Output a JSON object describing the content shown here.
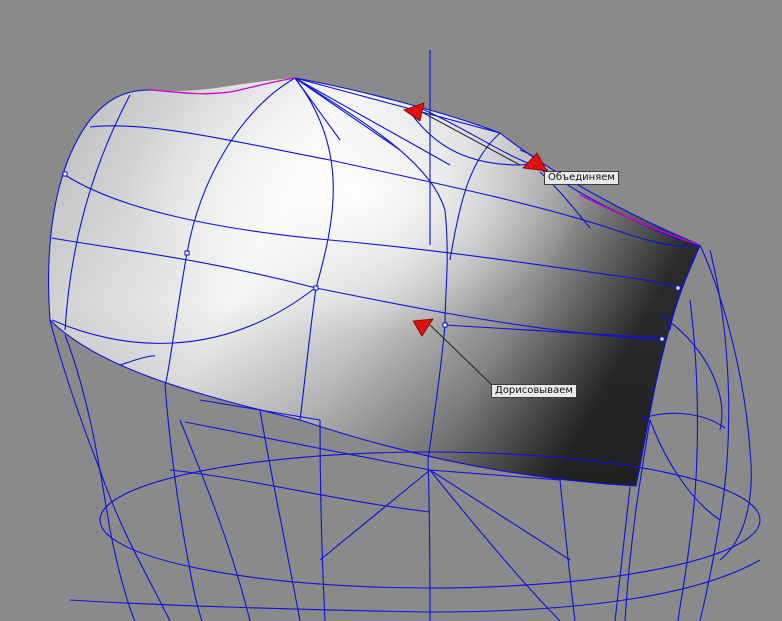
{
  "viewport": {
    "background_color": "#8a8a8a",
    "wire_color": "#0b12d8",
    "edge_highlight_color": "#d000d0",
    "arrow_color": "#e01010"
  },
  "annotations": {
    "merge_label": "Объединяем",
    "draw_label": "Дорисовываем"
  }
}
